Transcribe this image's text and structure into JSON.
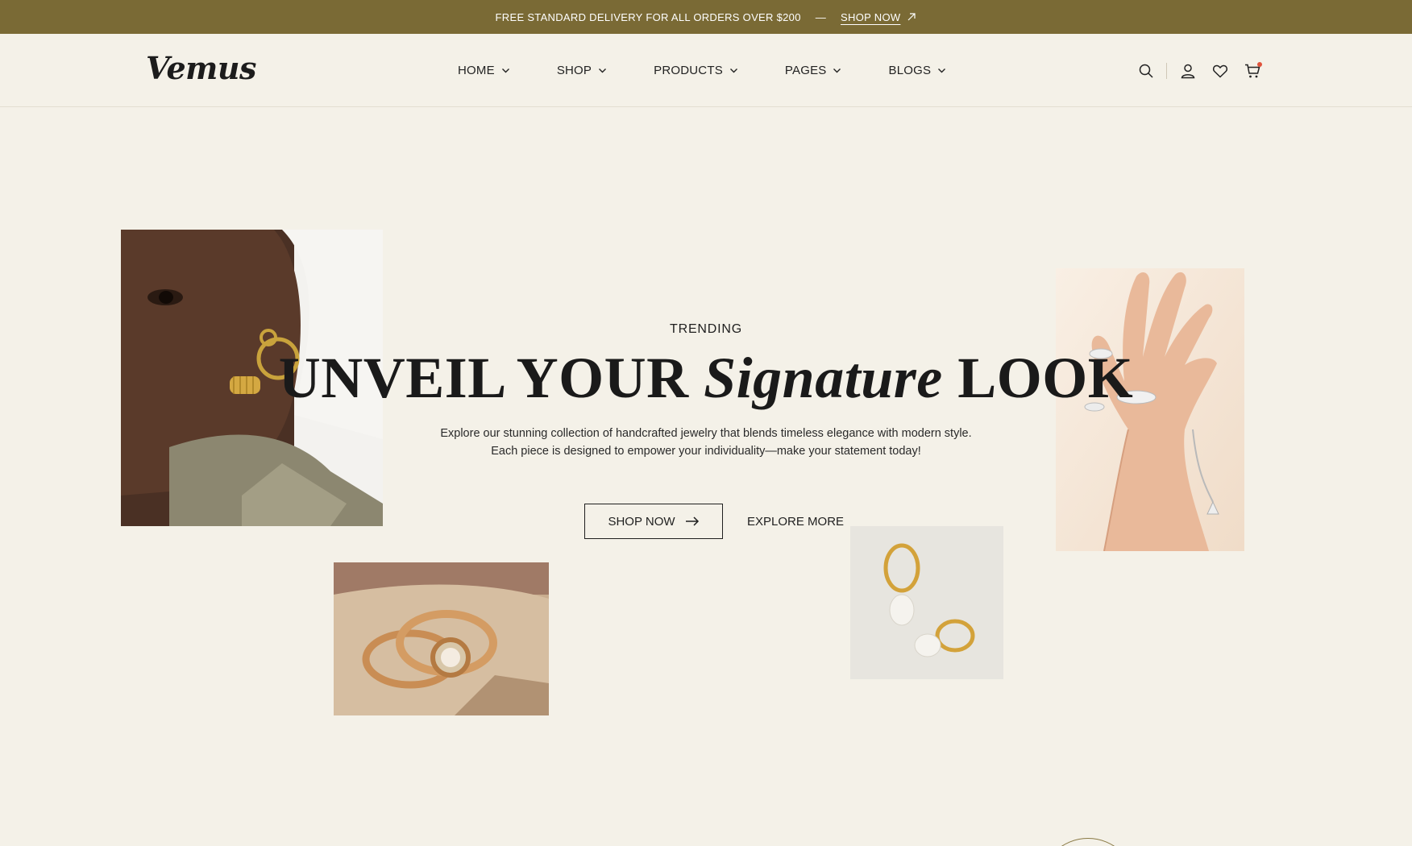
{
  "topbar": {
    "message": "FREE STANDARD DELIVERY FOR ALL ORDERS OVER $200",
    "separator": "—",
    "link_label": "SHOP NOW"
  },
  "header": {
    "logo": "Vemus",
    "nav": [
      {
        "label": "HOME"
      },
      {
        "label": "SHOP"
      },
      {
        "label": "PRODUCTS"
      },
      {
        "label": "PAGES"
      },
      {
        "label": "BLOGS"
      }
    ],
    "icons": [
      "search-icon",
      "user-icon",
      "heart-icon",
      "cart-icon"
    ]
  },
  "hero": {
    "eyebrow": "TRENDING",
    "title_part1": "UNVEIL YOUR ",
    "title_emphasis": "Signature",
    "title_part2": " LOOK",
    "description_line1": "Explore our stunning collection of handcrafted jewelry that blends timeless elegance with modern style.",
    "description_line2": "Each piece is designed to empower your individuality—make your statement today!",
    "primary_button": "SHOP NOW",
    "secondary_button": "EXPLORE MORE"
  },
  "colors": {
    "background": "#f4f1e8",
    "topbar": "#7a6a35",
    "text": "#1f1f1f",
    "cart_badge": "#e0533b"
  }
}
